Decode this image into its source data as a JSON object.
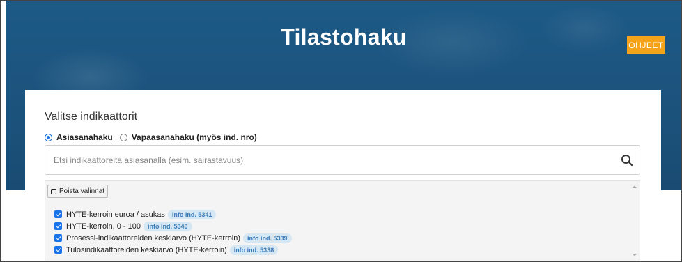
{
  "header": {
    "title": "Tilastohaku",
    "help_label": "OHJEET"
  },
  "indicators": {
    "section_title": "Valitse indikaattorit",
    "search_modes": [
      {
        "label": "Asiasanahaku",
        "selected": true
      },
      {
        "label": "Vapaasanahaku (myös ind. nro)",
        "selected": false
      }
    ],
    "search": {
      "placeholder": "Etsi indikaattoreita asiasanalla (esim. sairastavuus)",
      "value": ""
    },
    "clear_label": "Poista valinnat",
    "items": [
      {
        "label": "HYTE-kerroin euroa / asukas",
        "info": "info ind. 5341",
        "checked": true
      },
      {
        "label": "HYTE-kerroin, 0 - 100",
        "info": "info ind. 5340",
        "checked": true
      },
      {
        "label": "Prosessi-indikaattoreiden keskiarvo (HYTE-kerroin)",
        "info": "info ind. 5339",
        "checked": true
      },
      {
        "label": "Tulosindikaattoreiden keskiarvo (HYTE-kerroin)",
        "info": "info ind. 5338",
        "checked": true
      }
    ]
  },
  "colors": {
    "header_bg": "#1d5a86",
    "accent": "#f5a31a",
    "primary": "#1a73e8",
    "info_badge_bg": "#d6e7f4",
    "info_badge_text": "#3a7cb8"
  }
}
